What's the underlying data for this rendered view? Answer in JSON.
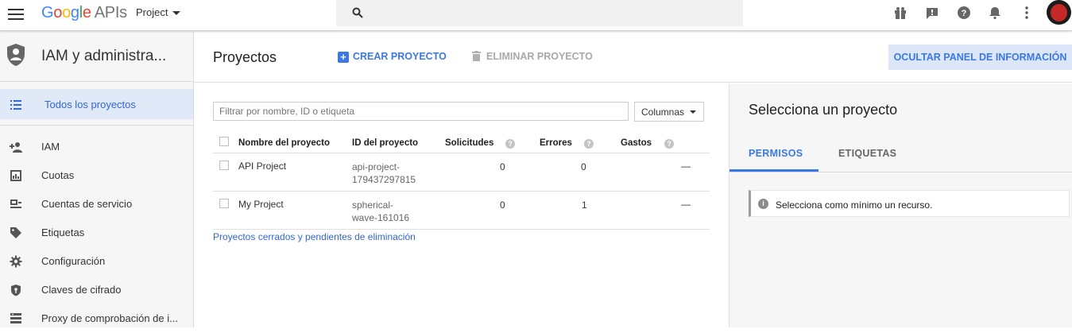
{
  "header": {
    "logo_google": "Google",
    "logo_apis": "APIs",
    "project_picker": "Project",
    "search_placeholder": ""
  },
  "sidebar": {
    "title": "IAM y administra...",
    "items": [
      {
        "label": "Todos los proyectos",
        "icon": "list-icon",
        "active": true
      },
      {
        "label": "IAM",
        "icon": "person-add-icon"
      },
      {
        "label": "Cuotas",
        "icon": "quota-icon"
      },
      {
        "label": "Cuentas de servicio",
        "icon": "service-account-icon"
      },
      {
        "label": "Etiquetas",
        "icon": "label-icon"
      },
      {
        "label": "Configuración",
        "icon": "gear-icon"
      },
      {
        "label": "Claves de cifrado",
        "icon": "shield-key-icon"
      },
      {
        "label": "Proxy de comprobación de i...",
        "icon": "proxy-icon"
      }
    ]
  },
  "main": {
    "title": "Proyectos",
    "create_label": "CREAR PROYECTO",
    "delete_label": "ELIMINAR PROYECTO",
    "hide_panel_label": "OCULTAR PANEL DE INFORMACIÓN",
    "filter_placeholder": "Filtrar por nombre, ID o etiqueta",
    "columns_label": "Columnas",
    "table": {
      "headers": [
        "Nombre del proyecto",
        "ID del proyecto",
        "Solicitudes",
        "Errores",
        "Gastos"
      ],
      "rows": [
        {
          "name": "API Project",
          "id_line1": "api-project-",
          "id_line2": "179437297815",
          "requests": "0",
          "errors": "0",
          "costs": "—"
        },
        {
          "name": "My Project",
          "id_line1": "spherical-",
          "id_line2": "wave-161016",
          "requests": "0",
          "errors": "1",
          "costs": "—"
        }
      ]
    },
    "closed_link": "Proyectos cerrados y pendientes de eliminación"
  },
  "info_panel": {
    "title": "Selecciona un proyecto",
    "tabs": [
      "PERMISOS",
      "ETIQUETAS"
    ],
    "active_tab": "PERMISOS",
    "notice": "Selecciona como mínimo un recurso."
  },
  "colors": {
    "accent": "#3b78e7",
    "active_bg": "#dfe9f8",
    "sidebar_bg": "#f6f6f6"
  }
}
